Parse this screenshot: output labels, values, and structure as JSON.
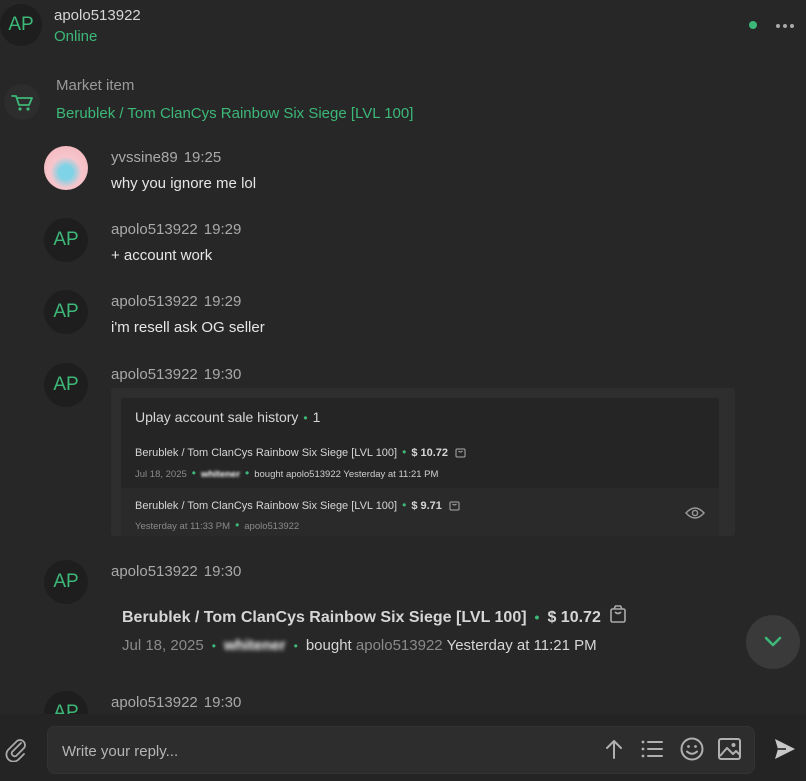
{
  "header": {
    "avatar_initials": "AP",
    "username": "apolo513922",
    "status": "Online",
    "status_color": "#3cb878"
  },
  "market": {
    "label": "Market item",
    "title": "Berublek / Tom ClanCys Rainbow Six Siege [LVL 100]"
  },
  "messages": [
    {
      "user": "yvssine89",
      "time": "19:25",
      "text": "why you ignore me lol"
    },
    {
      "avatar": "AP",
      "user": "apolo513922",
      "time": "19:29",
      "text": "+ account work"
    },
    {
      "avatar": "AP",
      "user": "apolo513922",
      "time": "19:29",
      "text": "i'm resell ask OG seller"
    },
    {
      "avatar": "AP",
      "user": "apolo513922",
      "time": "19:30"
    },
    {
      "avatar": "AP",
      "user": "apolo513922",
      "time": "19:30"
    },
    {
      "avatar": "AP",
      "user": "apolo513922",
      "time": "19:30"
    }
  ],
  "card": {
    "title": "Uplay account sale history",
    "count": "1",
    "row1": {
      "item": "Berublek / Tom ClanCys Rainbow Six Siege [LVL 100]",
      "price": "$ 10.72",
      "date": "Jul 18, 2025",
      "buyer": "whitener",
      "action": "bought",
      "seller": "apolo513922",
      "when": "Yesterday at 11:21 PM"
    },
    "row2": {
      "item": "Berublek / Tom ClanCys Rainbow Six Siege [LVL 100]",
      "price": "$ 9.71",
      "when": "Yesterday at 11:33 PM",
      "seller": "apolo513922"
    }
  },
  "sale": {
    "item": "Berublek / Tom ClanCys Rainbow Six Siege [LVL 100]",
    "price": "$ 10.72",
    "date": "Jul 18, 2025",
    "buyer": "whitener",
    "action": "bought",
    "seller": "apolo513922",
    "when": "Yesterday at 11:21 PM"
  },
  "composer": {
    "placeholder": "Write your reply..."
  },
  "colors": {
    "accent": "#3cb878",
    "background": "#272727"
  },
  "icons": [
    "paperclip-icon",
    "arrow-up-icon",
    "list-icon",
    "emoji-icon",
    "image-icon",
    "send-icon",
    "chevron-down-icon",
    "cart-icon",
    "eye-icon",
    "shopping-bag-icon",
    "more-icon"
  ]
}
